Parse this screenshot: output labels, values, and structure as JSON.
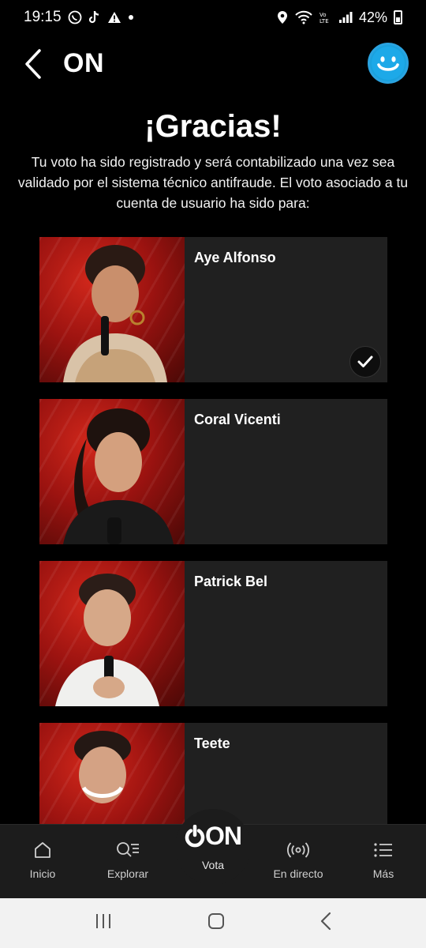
{
  "status_bar": {
    "time": "19:15",
    "battery": "42%"
  },
  "header": {
    "title": "ON"
  },
  "thanks": {
    "title": "¡Gracias!",
    "message": "Tu voto ha sido registrado y será contabilizado una vez sea validado por el sistema técnico antifraude. El voto asociado a tu cuenta de usuario ha sido para:"
  },
  "candidates": [
    {
      "name": "Aye Alfonso",
      "selected": true
    },
    {
      "name": "Coral Vicenti",
      "selected": false
    },
    {
      "name": "Patrick Bel",
      "selected": false
    },
    {
      "name": "Teete",
      "selected": false
    }
  ],
  "bottom_nav": {
    "items": [
      {
        "label": "Inicio",
        "icon": "home-icon"
      },
      {
        "label": "Explorar",
        "icon": "explore-icon"
      },
      {
        "label": "Vota",
        "icon": "on-logo-icon",
        "logo_text": "ON"
      },
      {
        "label": "En directo",
        "icon": "live-icon"
      },
      {
        "label": "Más",
        "icon": "menu-icon"
      }
    ]
  },
  "colors": {
    "background": "#000000",
    "card": "#202020",
    "accent": "#1da9e8",
    "nav": "#1c1c1c"
  }
}
